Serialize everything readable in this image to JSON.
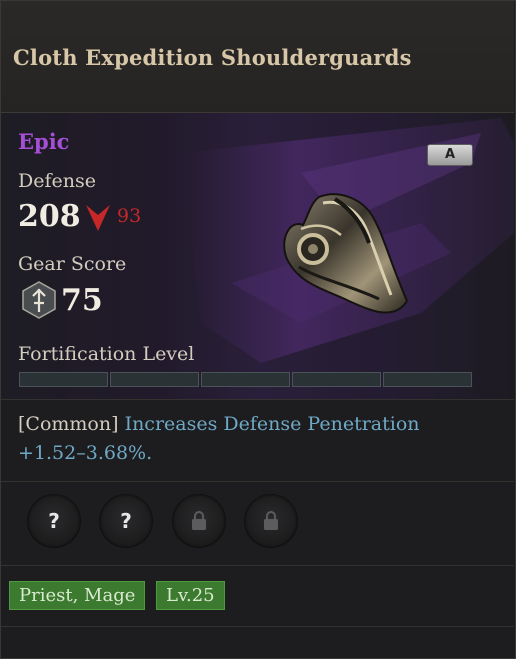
{
  "item": {
    "name": "Cloth Expedition Shoulderguards",
    "rarity": "Epic",
    "grade": "A",
    "defense_label": "Defense",
    "defense_value": "208",
    "defense_diff": "93",
    "gear_score_label": "Gear Score",
    "gear_score_value": "75",
    "fortification_label": "Fortification Level",
    "fortification_level": 0,
    "fortification_max": 5
  },
  "effect": {
    "tag": "[Common]",
    "text_part1": "Increases Defense Penetration",
    "text_part2": "+1.52–3.68%."
  },
  "sockets": [
    {
      "state": "unknown",
      "symbol": "?"
    },
    {
      "state": "unknown",
      "symbol": "?"
    },
    {
      "state": "locked",
      "icon": "lock-icon"
    },
    {
      "state": "locked",
      "icon": "lock-icon"
    }
  ],
  "requirements": {
    "classes": "Priest, Mage",
    "level": "Lv.25"
  },
  "colors": {
    "epic": "#a54fd6",
    "defense_decrease": "#c62828",
    "effect_text": "#6fa9c6",
    "tag_green": "#3c7a2f"
  }
}
